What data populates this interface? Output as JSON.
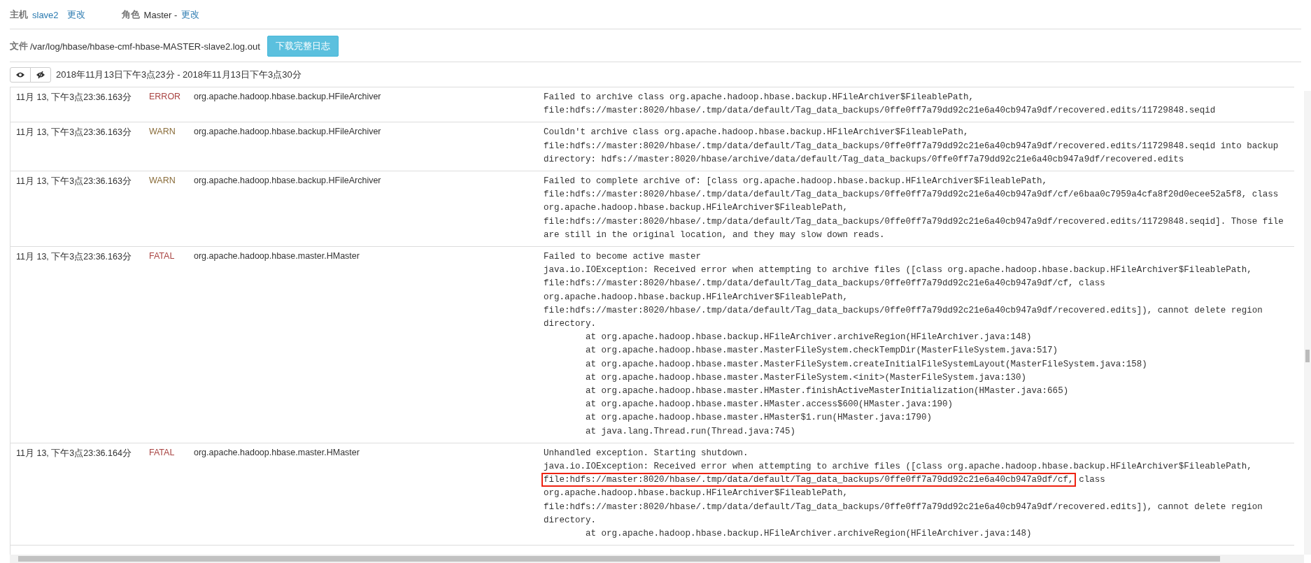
{
  "host": {
    "label": "主机",
    "value": "slave2",
    "action": "更改"
  },
  "role": {
    "label": "角色",
    "value": "Master -",
    "action": "更改"
  },
  "file": {
    "label": "文件",
    "path": "/var/log/hbase/hbase-cmf-hbase-MASTER-slave2.log.out",
    "download_button": "下载完整日志"
  },
  "range": "2018年11月13日下午3点23分 - 2018年11月13日下午3点30分",
  "rows": [
    {
      "time": "11月 13, 下午3点23:36.163分",
      "severity": "ERROR",
      "color": "#a94442",
      "source": "org.apache.hadoop.hbase.backup.HFileArchiver",
      "lines": [
        {
          "text": "Failed to archive class org.apache.hadoop.hbase.backup.HFileArchiver$FileablePath,"
        },
        {
          "text": "file:hdfs://master:8020/hbase/.tmp/data/default/Tag_data_backups/0ffe0ff7a79dd92c21e6a40cb947a9df/recovered.edits/11729848.seqid"
        }
      ]
    },
    {
      "time": "11月 13, 下午3点23:36.163分",
      "severity": "WARN",
      "color": "#8a6d3b",
      "source": "org.apache.hadoop.hbase.backup.HFileArchiver",
      "lines": [
        {
          "text": "Couldn't archive class org.apache.hadoop.hbase.backup.HFileArchiver$FileablePath,"
        },
        {
          "text": "file:hdfs://master:8020/hbase/.tmp/data/default/Tag_data_backups/0ffe0ff7a79dd92c21e6a40cb947a9df/recovered.edits/11729848.seqid into backup"
        },
        {
          "text": "directory: hdfs://master:8020/hbase/archive/data/default/Tag_data_backups/0ffe0ff7a79dd92c21e6a40cb947a9df/recovered.edits"
        }
      ]
    },
    {
      "time": "11月 13, 下午3点23:36.163分",
      "severity": "WARN",
      "color": "#8a6d3b",
      "source": "org.apache.hadoop.hbase.backup.HFileArchiver",
      "lines": [
        {
          "text": "Failed to complete archive of: [class org.apache.hadoop.hbase.backup.HFileArchiver$FileablePath,"
        },
        {
          "text": "file:hdfs://master:8020/hbase/.tmp/data/default/Tag_data_backups/0ffe0ff7a79dd92c21e6a40cb947a9df/cf/e6baa0c7959a4cfa8f20d0ecee52a5f8, class"
        },
        {
          "text": "org.apache.hadoop.hbase.backup.HFileArchiver$FileablePath,"
        },
        {
          "text": "file:hdfs://master:8020/hbase/.tmp/data/default/Tag_data_backups/0ffe0ff7a79dd92c21e6a40cb947a9df/recovered.edits/11729848.seqid]. Those file"
        },
        {
          "text": "are still in the original location, and they may slow down reads."
        }
      ]
    },
    {
      "time": "11月 13, 下午3点23:36.163分",
      "severity": "FATAL",
      "color": "#a94442",
      "source": "org.apache.hadoop.hbase.master.HMaster",
      "lines": [
        {
          "text": "Failed to become active master"
        },
        {
          "text": "java.io.IOException: Received error when attempting to archive files ([class org.apache.hadoop.hbase.backup.HFileArchiver$FileablePath,"
        },
        {
          "text": "file:hdfs://master:8020/hbase/.tmp/data/default/Tag_data_backups/0ffe0ff7a79dd92c21e6a40cb947a9df/cf, class"
        },
        {
          "text": "org.apache.hadoop.hbase.backup.HFileArchiver$FileablePath,"
        },
        {
          "text": "file:hdfs://master:8020/hbase/.tmp/data/default/Tag_data_backups/0ffe0ff7a79dd92c21e6a40cb947a9df/recovered.edits]), cannot delete region"
        },
        {
          "text": "directory."
        },
        {
          "text": "\tat org.apache.hadoop.hbase.backup.HFileArchiver.archiveRegion(HFileArchiver.java:148)"
        },
        {
          "text": "\tat org.apache.hadoop.hbase.master.MasterFileSystem.checkTempDir(MasterFileSystem.java:517)"
        },
        {
          "text": "\tat org.apache.hadoop.hbase.master.MasterFileSystem.createInitialFileSystemLayout(MasterFileSystem.java:158)"
        },
        {
          "text": "\tat org.apache.hadoop.hbase.master.MasterFileSystem.<init>(MasterFileSystem.java:130)"
        },
        {
          "text": "\tat org.apache.hadoop.hbase.master.HMaster.finishActiveMasterInitialization(HMaster.java:665)"
        },
        {
          "text": "\tat org.apache.hadoop.hbase.master.HMaster.access$600(HMaster.java:190)"
        },
        {
          "text": "\tat org.apache.hadoop.hbase.master.HMaster$1.run(HMaster.java:1790)"
        },
        {
          "text": "\tat java.lang.Thread.run(Thread.java:745)"
        }
      ]
    },
    {
      "time": "11月 13, 下午3点23:36.164分",
      "severity": "FATAL",
      "color": "#a94442",
      "source": "org.apache.hadoop.hbase.master.HMaster",
      "lines": [
        {
          "text": "Unhandled exception. Starting shutdown."
        },
        {
          "text": "java.io.IOException: Received error when attempting to archive files ([class org.apache.hadoop.hbase.backup.HFileArchiver$FileablePath,"
        },
        {
          "text": "file:hdfs://master:8020/hbase/.tmp/data/default/Tag_data_backups/0ffe0ff7a79dd92c21e6a40cb947a9df/cf,",
          "tail": " class",
          "marked": true
        },
        {
          "text": "org.apache.hadoop.hbase.backup.HFileArchiver$FileablePath,"
        },
        {
          "text": "file:hdfs://master:8020/hbase/.tmp/data/default/Tag_data_backups/0ffe0ff7a79dd92c21e6a40cb947a9df/recovered.edits]), cannot delete region"
        },
        {
          "text": "directory."
        },
        {
          "text": "\tat org.apache.hadoop.hbase.backup.HFileArchiver.archiveRegion(HFileArchiver.java:148)"
        }
      ]
    }
  ]
}
